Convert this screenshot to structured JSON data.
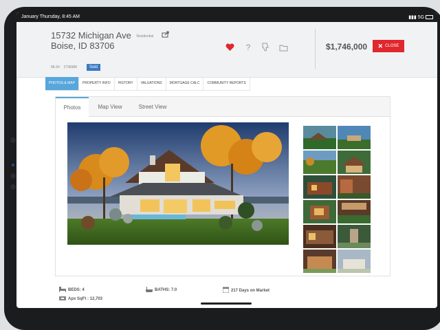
{
  "status_bar": {
    "time": "January Thursday, 8:45 AM",
    "signal": "5G"
  },
  "listing": {
    "address_line1": "15732 Michigan Ave",
    "type": "Residential",
    "address_line2": "Boise, ID 83706",
    "mls_label": "MLS#",
    "mls_number": "2738988",
    "status": "Sold",
    "price": "$1,746,000",
    "close_label": "CLOSE"
  },
  "tabs": [
    {
      "label": "PHOTOS & MAP"
    },
    {
      "label": "PROPERTY INFO"
    },
    {
      "label": "HISTORY"
    },
    {
      "label": "VALUATIONS"
    },
    {
      "label": "MORTGAGE CALC"
    },
    {
      "label": "COMMUNITY REPORTS"
    }
  ],
  "subtabs": [
    {
      "label": "Photos"
    },
    {
      "label": "Map View"
    },
    {
      "label": "Street View"
    }
  ],
  "stats": {
    "beds": "BEDS: 4",
    "baths": "BATHS: 7.0",
    "days": "217 Days on Market",
    "sqft": "Apx SqFt : 12,703"
  },
  "colors": {
    "accent": "#58a7dc",
    "sold": "#3b79c2",
    "close": "#e0262e",
    "heart": "#e0262e"
  },
  "icons": [
    "heart-icon",
    "question-icon",
    "thumbs-down-icon",
    "folder-icon",
    "share-icon",
    "close-x-icon",
    "bed-icon",
    "bath-icon",
    "calendar-icon",
    "ruler-icon"
  ]
}
